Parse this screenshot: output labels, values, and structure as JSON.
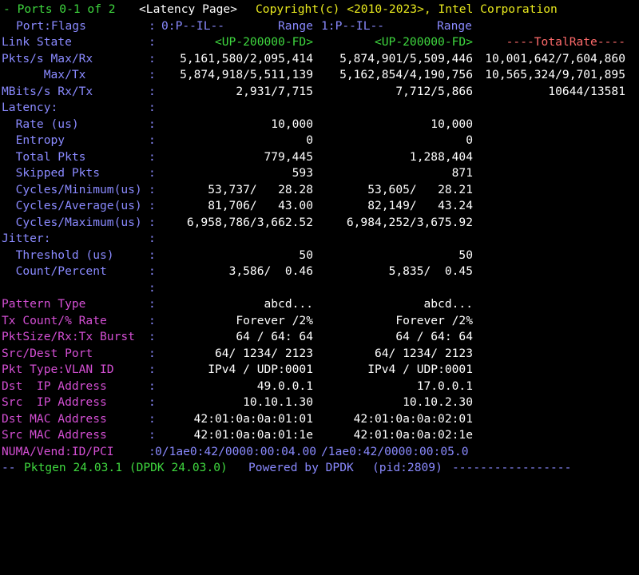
{
  "header": {
    "ports_label": "- Ports 0-1 of 2",
    "page_name": "<Latency Page>",
    "copyright": "Copyright(c) <2010-2023>, Intel Corporation"
  },
  "ports_flags": {
    "label": "Port:Flags",
    "p0": "0:P--IL--",
    "p0_range": "Range",
    "p1": "1:P--IL--",
    "p1_range": "Range"
  },
  "link_state": {
    "label": "Link State",
    "p0": "<UP-200000-FD>",
    "p1": "<UP-200000-FD>",
    "total": "----TotalRate----"
  },
  "rates": [
    {
      "label": "Pkts/s Max/Rx",
      "p0": "5,161,580/2,095,414",
      "p1": "5,874,901/5,509,446",
      "total": "10,001,642/7,604,860"
    },
    {
      "label": "      Max/Tx",
      "p0": "5,874,918/5,511,139",
      "p1": "5,162,854/4,190,756",
      "total": "10,565,324/9,701,895"
    },
    {
      "label": "MBits/s Rx/Tx",
      "p0": "2,931/7,715",
      "p1": "7,712/5,866",
      "total": "10644/13581"
    }
  ],
  "latency": {
    "label": "Latency:",
    "rows": [
      {
        "label": "  Rate (us)",
        "p0": "10,000",
        "p1": "10,000"
      },
      {
        "label": "  Entropy",
        "p0": "0",
        "p1": "0"
      },
      {
        "label": "  Total Pkts",
        "p0": "779,445",
        "p1": "1,288,404"
      },
      {
        "label": "  Skipped Pkts",
        "p0": "593",
        "p1": "871"
      },
      {
        "label": "  Cycles/Minimum(us)",
        "p0": "53,737/   28.28",
        "p1": "53,605/   28.21"
      },
      {
        "label": "  Cycles/Average(us)",
        "p0": "81,706/   43.00",
        "p1": "82,149/   43.24"
      },
      {
        "label": "  Cycles/Maximum(us)",
        "p0": "6,958,786/3,662.52",
        "p1": "6,984,252/3,675.92"
      }
    ]
  },
  "jitter": {
    "label": "Jitter:",
    "rows": [
      {
        "label": "  Threshold (us)",
        "p0": "50",
        "p1": "50"
      },
      {
        "label": "  Count/Percent",
        "p0": "3,586/  0.46",
        "p1": "5,835/  0.45"
      }
    ]
  },
  "separator": ":",
  "pattern": [
    {
      "label": "Pattern Type",
      "p0": "abcd...",
      "p1": "abcd..."
    },
    {
      "label": "Tx Count/% Rate",
      "p0": "Forever /2%",
      "p1": "Forever /2%"
    },
    {
      "label": "PktSize/Rx:Tx Burst",
      "p0": "64 / 64: 64",
      "p1": "64 / 64: 64"
    },
    {
      "label": "Src/Dest Port",
      "p0": "64/ 1234/ 2123",
      "p1": "64/ 1234/ 2123"
    },
    {
      "label": "Pkt Type:VLAN ID",
      "p0": "IPv4 / UDP:0001",
      "p1": "IPv4 / UDP:0001"
    },
    {
      "label": "Dst  IP Address",
      "p0": "49.0.0.1",
      "p1": "17.0.0.1"
    },
    {
      "label": "Src  IP Address",
      "p0": "10.10.1.30",
      "p1": "10.10.2.30"
    },
    {
      "label": "Dst MAC Address",
      "p0": "42:01:0a:0a:01:01",
      "p1": "42:01:0a:0a:02:01"
    },
    {
      "label": "Src MAC Address",
      "p0": "42:01:0a:0a:01:1e",
      "p1": "42:01:0a:0a:02:1e"
    }
  ],
  "numa": {
    "label": "NUMA/Vend:ID/PCI",
    "p0": "0/1ae0:42/0000:00:04.00",
    "p1": "/1ae0:42/0000:00:05.0"
  },
  "footer": {
    "dashes_left": "--",
    "version": "Pktgen 24.03.1 (DPDK 24.03.0)",
    "powered": "Powered by DPDK",
    "pid": "(pid:2809)",
    "dashes_right": "-----------------"
  },
  "colors": {
    "background": "#000000",
    "label_blue": "#8a8aff",
    "label_magenta": "#d44fd4",
    "value_white": "#ffffff",
    "link_green": "#3fd83f",
    "copyright_yellow": "#e8e81e",
    "total_red": "#ff6b6b"
  }
}
